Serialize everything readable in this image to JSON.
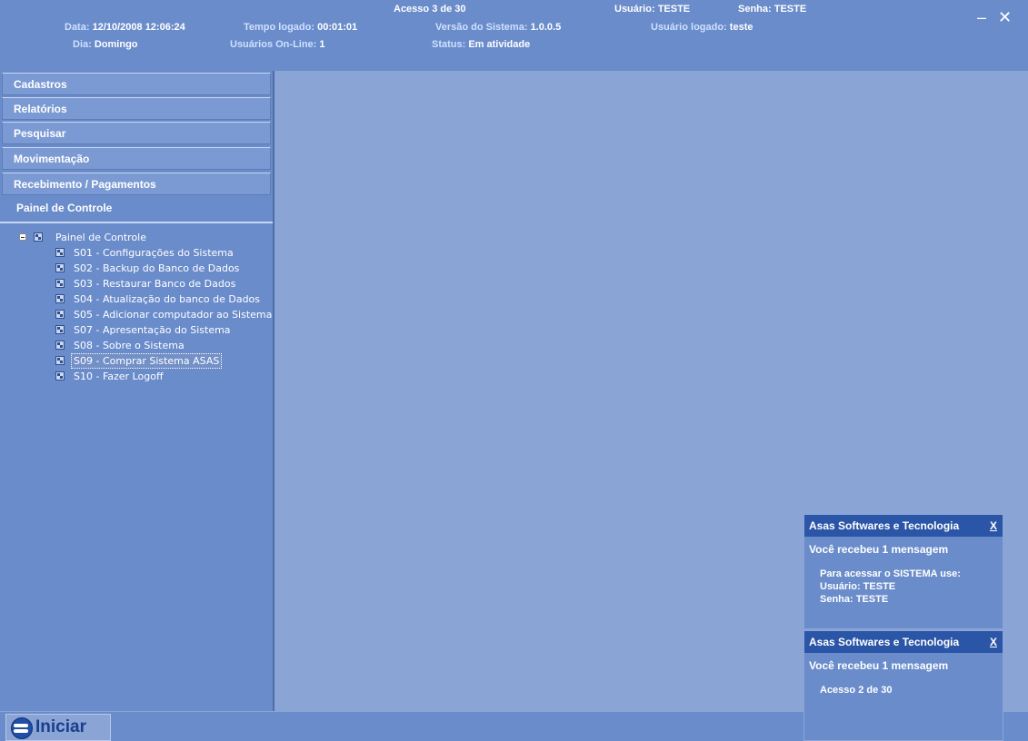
{
  "header": {
    "acesso": "Acesso 3  de 30",
    "usuario_label": "Usuário:",
    "usuario_value": "TESTE",
    "senha_label": "Senha:",
    "senha_value": "TESTE",
    "data_label": "Data:",
    "data_value": "12/10/2008 12:06:24",
    "tempo_label": "Tempo logado:",
    "tempo_value": "00:01:01",
    "versao_label": "Versão do Sistema:",
    "versao_value": "1.0.0.5",
    "usuario_logado_label": "Usuário logado:",
    "usuario_logado_value": "teste",
    "dia_label": "Dia:",
    "dia_value": "Domingo",
    "online_label": "Usuários On-Line:",
    "online_value": "1",
    "status_label": "Status:",
    "status_value": "Em atividade",
    "minimize": "–",
    "close": "✕"
  },
  "menu": [
    {
      "label": "Cadastros"
    },
    {
      "label": "Relatórios"
    },
    {
      "label": "Pesquisar"
    },
    {
      "label": " Movimentação"
    },
    {
      "label": "Recebimento / Pagamentos"
    }
  ],
  "panel_title": "Painel de Controle",
  "tree": {
    "root": "Painel de Controle",
    "items": [
      "S01 - Configurações do Sistema",
      "S02 - Backup do Banco de Dados",
      "S03 - Restaurar Banco de Dados",
      "S04 - Atualização do banco de Dados",
      "S05 - Adicionar computador ao Sistema",
      "S07 - Apresentação do Sistema",
      "S08 - Sobre o Sistema",
      "S09 - Comprar Sistema ASAS",
      "S10 - Fazer Logoff"
    ],
    "selected_index": 7
  },
  "notifications": [
    {
      "title": "Asas Softwares e Tecnologia",
      "close": "X",
      "subtitle": "Você recebeu 1 mensagem",
      "lines": [
        "Para acessar o SISTEMA use:",
        "Usuário: TESTE",
        "Senha: TESTE"
      ]
    },
    {
      "title": "Asas Softwares e Tecnologia",
      "close": "X",
      "subtitle": "Você recebeu 1 mensagem",
      "lines": [
        "Acesso 2 de 30"
      ]
    }
  ],
  "taskbar": {
    "start_label": "Iniciar"
  }
}
